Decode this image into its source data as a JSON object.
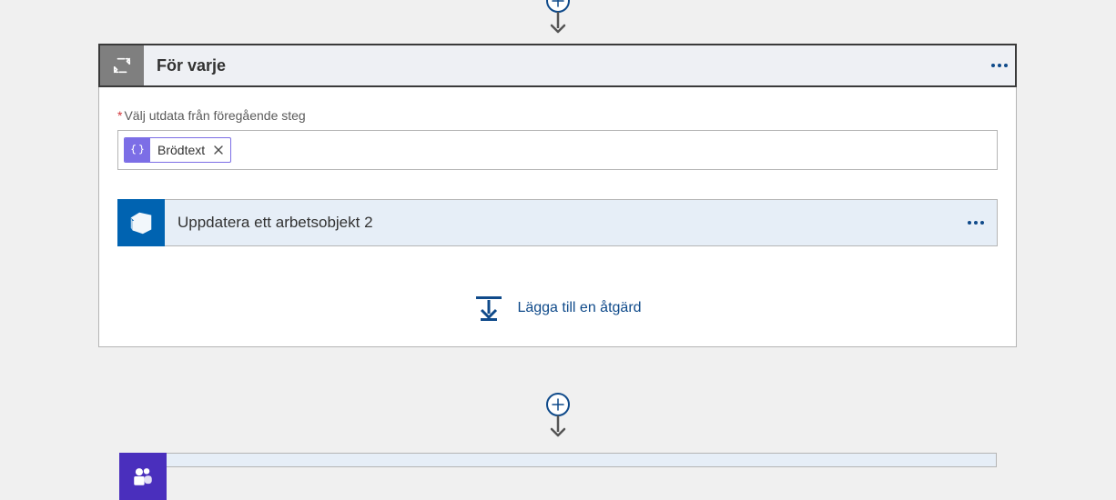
{
  "header": {
    "title": "För varje"
  },
  "field": {
    "label": "Välj utdata från föregående steg",
    "token_label": "Brödtext"
  },
  "innerAction": {
    "title": "Uppdatera ett arbetsobjekt 2"
  },
  "addAction": {
    "label": "Lägga till en åtgärd"
  }
}
